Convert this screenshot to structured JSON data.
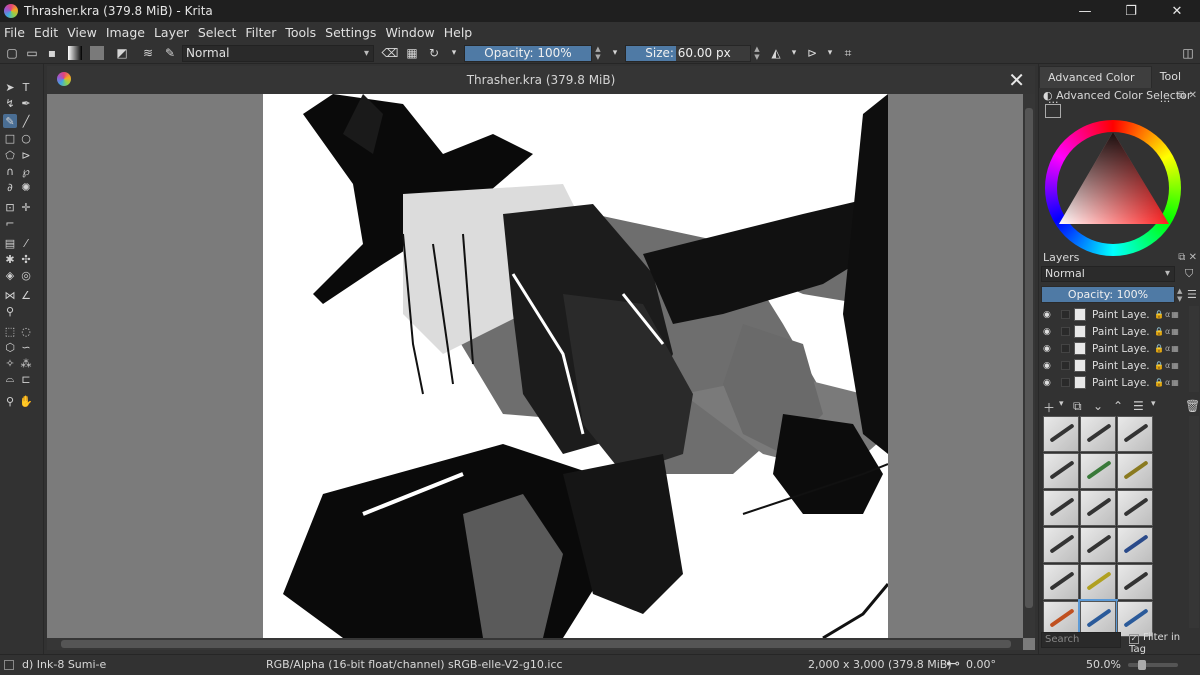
{
  "window": {
    "title": "Thrasher.kra (379.8 MiB)  - Krita",
    "minimize": "—",
    "maximize": "❐",
    "close": "✕"
  },
  "menu": [
    "File",
    "Edit",
    "View",
    "Image",
    "Layer",
    "Select",
    "Filter",
    "Tools",
    "Settings",
    "Window",
    "Help"
  ],
  "toolbar": {
    "blend_mode": "Normal",
    "opacity_label": "Opacity: 100%",
    "opacity_value": 1.0,
    "size_label_prefix": "Size: ",
    "size_value": "60.00 px"
  },
  "document": {
    "tab_title": "Thrasher.kra (379.8 MiB)",
    "close": "✕"
  },
  "dockers": {
    "tabs": [
      "Advanced Color ...",
      "Tool ..."
    ],
    "color_selector_title": "Advanced Color Selector",
    "layers_title": "Layers",
    "layer_blend_mode": "Normal",
    "layer_opacity": "Opacity:  100%",
    "layers": [
      {
        "name": "Paint Laye..."
      },
      {
        "name": "Paint Laye..."
      },
      {
        "name": "Paint Laye..."
      },
      {
        "name": "Paint Laye..."
      },
      {
        "name": "Paint Laye..."
      }
    ],
    "brush_search_placeholder": "Search",
    "filter_in_tag": "Filter in Tag"
  },
  "status": {
    "brush": "d) Ink-8 Sumi-e",
    "color_space": "RGB/Alpha (16-bit float/channel)  sRGB-elle-V2-g10.icc",
    "dimensions": "2,000 x 3,000 (379.8 MiB)",
    "rotation": "0.00°",
    "zoom": "50.0%"
  }
}
